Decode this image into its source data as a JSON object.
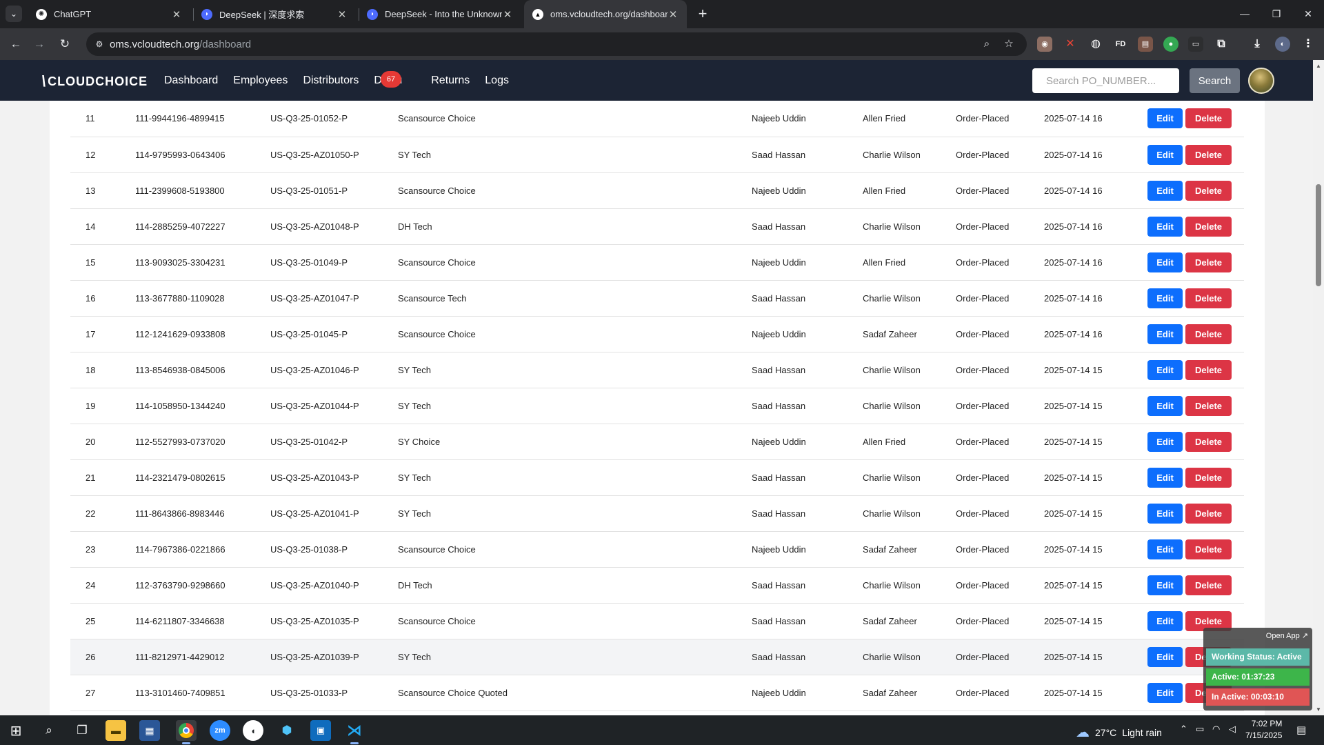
{
  "browser": {
    "tabs": [
      {
        "title": "ChatGPT",
        "icon": "chatgpt-icon",
        "active": false
      },
      {
        "title": "DeepSeek | 深度求索",
        "icon": "deepseek-icon",
        "active": false
      },
      {
        "title": "DeepSeek - Into the Unknown",
        "icon": "deepseek-icon",
        "active": false
      },
      {
        "title": "oms.vcloudtech.org/dashboard",
        "icon": "vercel-icon",
        "active": true
      }
    ],
    "url_host": "oms.vcloudtech.org",
    "url_path": "/dashboard"
  },
  "app": {
    "logo": "CLOUDCHOICE",
    "nav": [
      "Dashboard",
      "Employees",
      "Distributors",
      "Dispu",
      "Returns",
      "Logs"
    ],
    "disputes_badge": "67",
    "search_placeholder": "Search PO_NUMBER...",
    "search_button": "Search"
  },
  "table": {
    "rows": [
      {
        "num": "11",
        "order": "111-9944196-4899415",
        "po": "US-Q3-25-01052-P",
        "distributor": "Scansource Choice",
        "employee": "Najeeb Uddin",
        "manager": "Allen Fried",
        "status": "Order-Placed",
        "date": "2025-07-14 16"
      },
      {
        "num": "12",
        "order": "114-9795993-0643406",
        "po": "US-Q3-25-AZ01050-P",
        "distributor": "SY Tech",
        "employee": "Saad Hassan",
        "manager": "Charlie Wilson",
        "status": "Order-Placed",
        "date": "2025-07-14 16"
      },
      {
        "num": "13",
        "order": "111-2399608-5193800",
        "po": "US-Q3-25-01051-P",
        "distributor": "Scansource Choice",
        "employee": "Najeeb Uddin",
        "manager": "Allen Fried",
        "status": "Order-Placed",
        "date": "2025-07-14 16"
      },
      {
        "num": "14",
        "order": "114-2885259-4072227",
        "po": "US-Q3-25-AZ01048-P",
        "distributor": "DH Tech",
        "employee": "Saad Hassan",
        "manager": "Charlie Wilson",
        "status": "Order-Placed",
        "date": "2025-07-14 16"
      },
      {
        "num": "15",
        "order": "113-9093025-3304231",
        "po": "US-Q3-25-01049-P",
        "distributor": "Scansource Choice",
        "employee": "Najeeb Uddin",
        "manager": "Allen Fried",
        "status": "Order-Placed",
        "date": "2025-07-14 16"
      },
      {
        "num": "16",
        "order": "113-3677880-1109028",
        "po": "US-Q3-25-AZ01047-P",
        "distributor": "Scansource Tech",
        "employee": "Saad Hassan",
        "manager": "Charlie Wilson",
        "status": "Order-Placed",
        "date": "2025-07-14 16"
      },
      {
        "num": "17",
        "order": "112-1241629-0933808",
        "po": "US-Q3-25-01045-P",
        "distributor": "Scansource Choice",
        "employee": "Najeeb Uddin",
        "manager": "Sadaf Zaheer",
        "status": "Order-Placed",
        "date": "2025-07-14 16"
      },
      {
        "num": "18",
        "order": "113-8546938-0845006",
        "po": "US-Q3-25-AZ01046-P",
        "distributor": "SY Tech",
        "employee": "Saad Hassan",
        "manager": "Charlie Wilson",
        "status": "Order-Placed",
        "date": "2025-07-14 15"
      },
      {
        "num": "19",
        "order": "114-1058950-1344240",
        "po": "US-Q3-25-AZ01044-P",
        "distributor": "SY Tech",
        "employee": "Saad Hassan",
        "manager": "Charlie Wilson",
        "status": "Order-Placed",
        "date": "2025-07-14 15"
      },
      {
        "num": "20",
        "order": "112-5527993-0737020",
        "po": "US-Q3-25-01042-P",
        "distributor": "SY Choice",
        "employee": "Najeeb Uddin",
        "manager": "Allen Fried",
        "status": "Order-Placed",
        "date": "2025-07-14 15"
      },
      {
        "num": "21",
        "order": "114-2321479-0802615",
        "po": "US-Q3-25-AZ01043-P",
        "distributor": "SY Tech",
        "employee": "Saad Hassan",
        "manager": "Charlie Wilson",
        "status": "Order-Placed",
        "date": "2025-07-14 15"
      },
      {
        "num": "22",
        "order": "111-8643866-8983446",
        "po": "US-Q3-25-AZ01041-P",
        "distributor": "SY Tech",
        "employee": "Saad Hassan",
        "manager": "Charlie Wilson",
        "status": "Order-Placed",
        "date": "2025-07-14 15"
      },
      {
        "num": "23",
        "order": "114-7967386-0221866",
        "po": "US-Q3-25-01038-P",
        "distributor": "Scansource Choice",
        "employee": "Najeeb Uddin",
        "manager": "Sadaf Zaheer",
        "status": "Order-Placed",
        "date": "2025-07-14 15"
      },
      {
        "num": "24",
        "order": "112-3763790-9298660",
        "po": "US-Q3-25-AZ01040-P",
        "distributor": "DH Tech",
        "employee": "Saad Hassan",
        "manager": "Charlie Wilson",
        "status": "Order-Placed",
        "date": "2025-07-14 15"
      },
      {
        "num": "25",
        "order": "114-6211807-3346638",
        "po": "US-Q3-25-AZ01035-P",
        "distributor": "Scansource Choice",
        "employee": "Saad Hassan",
        "manager": "Sadaf Zaheer",
        "status": "Order-Placed",
        "date": "2025-07-14 15"
      },
      {
        "num": "26",
        "order": "111-8212971-4429012",
        "po": "US-Q3-25-AZ01039-P",
        "distributor": "SY Tech",
        "employee": "Saad Hassan",
        "manager": "Charlie Wilson",
        "status": "Order-Placed",
        "date": "2025-07-14 15"
      },
      {
        "num": "27",
        "order": "113-3101460-7409851",
        "po": "US-Q3-25-01033-P",
        "distributor": "Scansource Choice Quoted",
        "employee": "Najeeb Uddin",
        "manager": "Sadaf Zaheer",
        "status": "Order-Placed",
        "date": "2025-07-14 15"
      }
    ],
    "edit_label": "Edit",
    "delete_label": "Delete"
  },
  "working_status": {
    "open_app": "Open App ↗",
    "status": "Working Status: Active",
    "active": "Active: 01:37:23",
    "inactive": "In Active: 00:03:10",
    "colors": {
      "status": "#5cb8a8",
      "active": "#3db54a",
      "inactive": "#e05555"
    }
  },
  "taskbar": {
    "weather_temp": "27°C",
    "weather_desc": "Light rain",
    "time": "7:02 PM",
    "date": "7/15/2025"
  },
  "colors": {
    "app_header": "#1c2434",
    "edit": "#0d6efd",
    "delete": "#dc3545",
    "badge": "#e53935"
  }
}
